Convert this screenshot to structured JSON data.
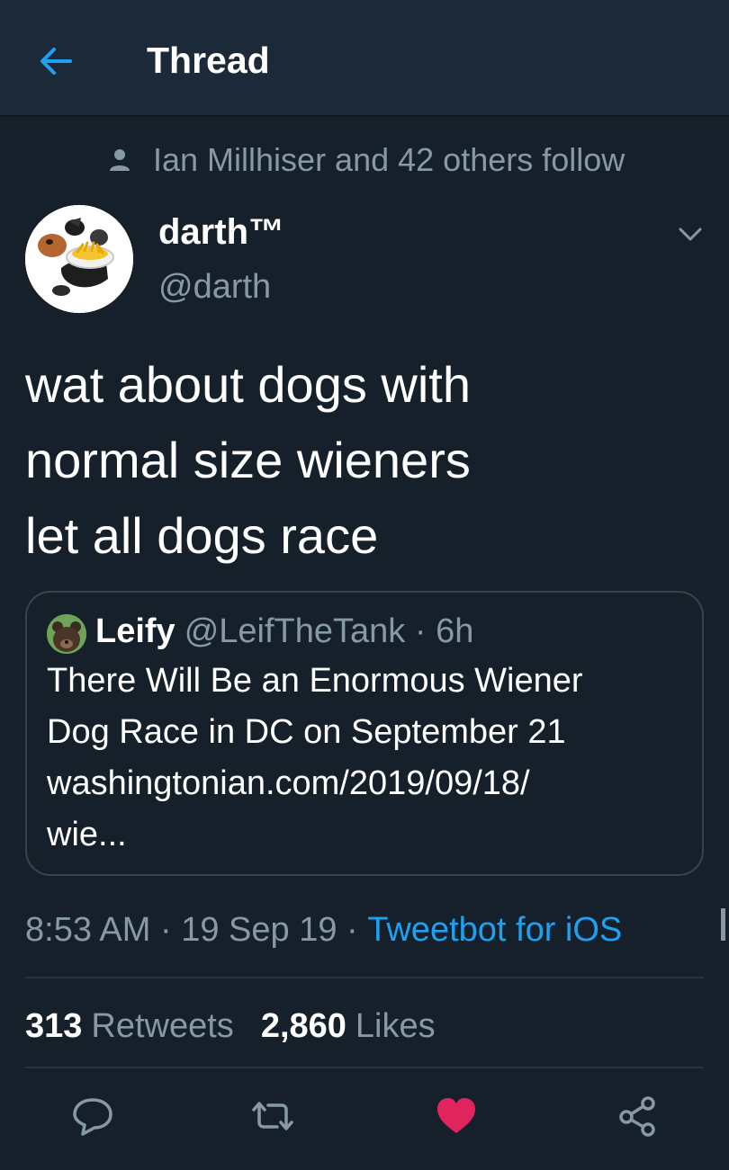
{
  "header": {
    "title": "Thread",
    "back_icon": "arrow-left-icon"
  },
  "social_context": {
    "icon": "person-icon",
    "text": "Ian Millhiser and 42 others follow"
  },
  "author": {
    "display_name": "darth™",
    "handle": "@darth"
  },
  "tweet": {
    "lines": [
      "wat about dogs with",
      "normal size wieners",
      "let all dogs race"
    ]
  },
  "quoted_tweet": {
    "name": "Leify",
    "handle_time": "@LeifTheTank · 6h",
    "lines": [
      "There Will Be an Enormous Wiener",
      "Dog Race in DC on September 21",
      "washingtonian.com/2019/09/18/",
      "wie..."
    ]
  },
  "meta": {
    "time": "8:53 AM",
    "sep1": " · ",
    "date": "19 Sep 19",
    "sep2": " · ",
    "source": "Tweetbot for iOS"
  },
  "stats": {
    "retweets_count": "313",
    "retweets_label": "Retweets",
    "likes_count": "2,860",
    "likes_label": "Likes"
  },
  "colors": {
    "background": "#15202b",
    "header": "#1c2938",
    "accent": "#1da1f2",
    "secondary_text": "#8899a6",
    "like": "#e0245e"
  },
  "action_icons": [
    "reply-icon",
    "retweet-icon",
    "heart-icon",
    "share-icon"
  ]
}
